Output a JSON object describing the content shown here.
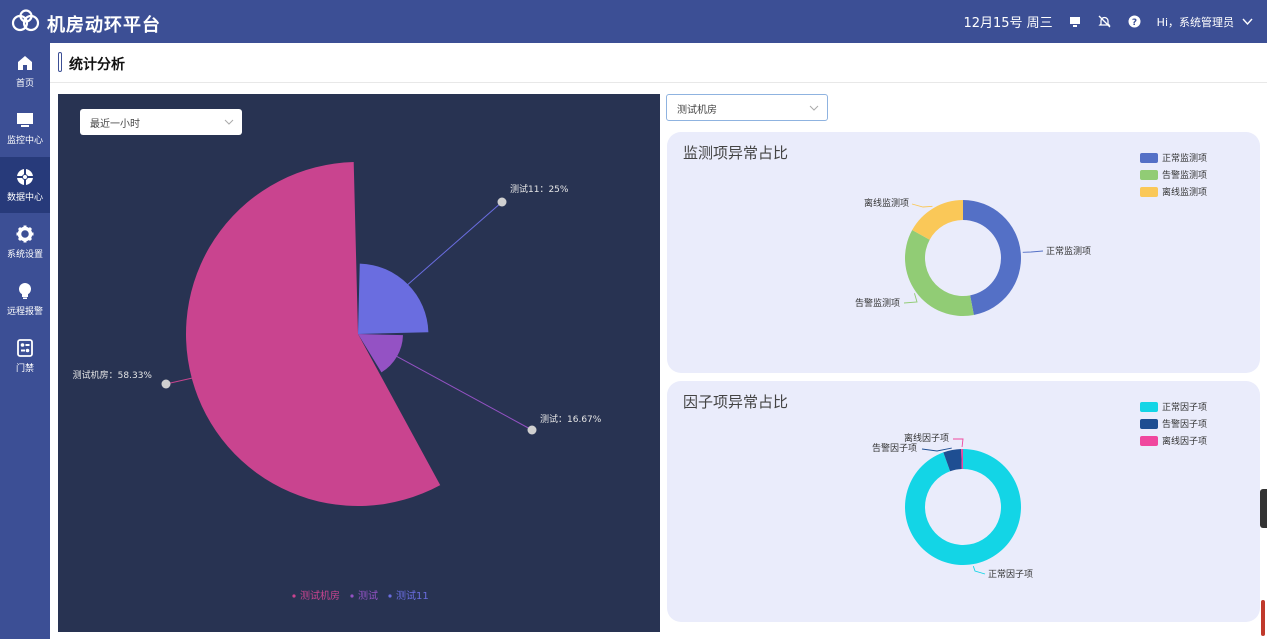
{
  "header": {
    "app_title": "机房动环平台",
    "date": "12月15号 周三",
    "user_greeting": "Hi，系统管理员",
    "icons": [
      "monitor-icon",
      "bell-off-icon",
      "help-icon",
      "chevron-down-icon"
    ]
  },
  "sidebar": {
    "items": [
      {
        "label": "首页",
        "icon": "home-icon"
      },
      {
        "label": "监控中心",
        "icon": "monitor-icon"
      },
      {
        "label": "数据中心",
        "icon": "data-icon",
        "active": true
      },
      {
        "label": "系统设置",
        "icon": "gear-icon"
      },
      {
        "label": "远程报警",
        "icon": "bulb-icon"
      },
      {
        "label": "门禁",
        "icon": "access-icon"
      }
    ]
  },
  "page": {
    "title": "统计分析"
  },
  "left_panel": {
    "time_select": "最近一小时"
  },
  "right_panel": {
    "room_select": "测试机房"
  },
  "colors": {
    "brand": "#3c4f95",
    "panel_bg": "#283352",
    "card_bg": "#eaecfb"
  },
  "chart_data": [
    {
      "type": "pie",
      "subtype": "rose",
      "categories": [
        "测试机房",
        "测试",
        "测试11"
      ],
      "values": [
        58.33,
        16.67,
        25
      ],
      "labels": [
        "测试机房：58.33%",
        "测试：16.67%",
        "测试11：25%"
      ],
      "colors": [
        "#c9448f",
        "#9452c4",
        "#6a6de0"
      ],
      "legend": [
        "测试机房",
        "测试",
        "测试11"
      ],
      "legend_position": "bottom-center"
    },
    {
      "type": "pie",
      "subtype": "donut",
      "title": "监测项异常占比",
      "categories": [
        "正常监测项",
        "告警监测项",
        "离线监测项"
      ],
      "values": [
        47,
        36,
        17
      ],
      "colors": [
        "#5470c6",
        "#91cc75",
        "#fac858"
      ],
      "legend_position": "top-right"
    },
    {
      "type": "pie",
      "subtype": "donut",
      "title": "因子项异常占比",
      "categories": [
        "正常因子项",
        "告警因子项",
        "离线因子项"
      ],
      "values": [
        94.5,
        5,
        0.5
      ],
      "colors": [
        "#13d5e6",
        "#1e4e92",
        "#f0479e"
      ],
      "legend_position": "top-right"
    }
  ]
}
